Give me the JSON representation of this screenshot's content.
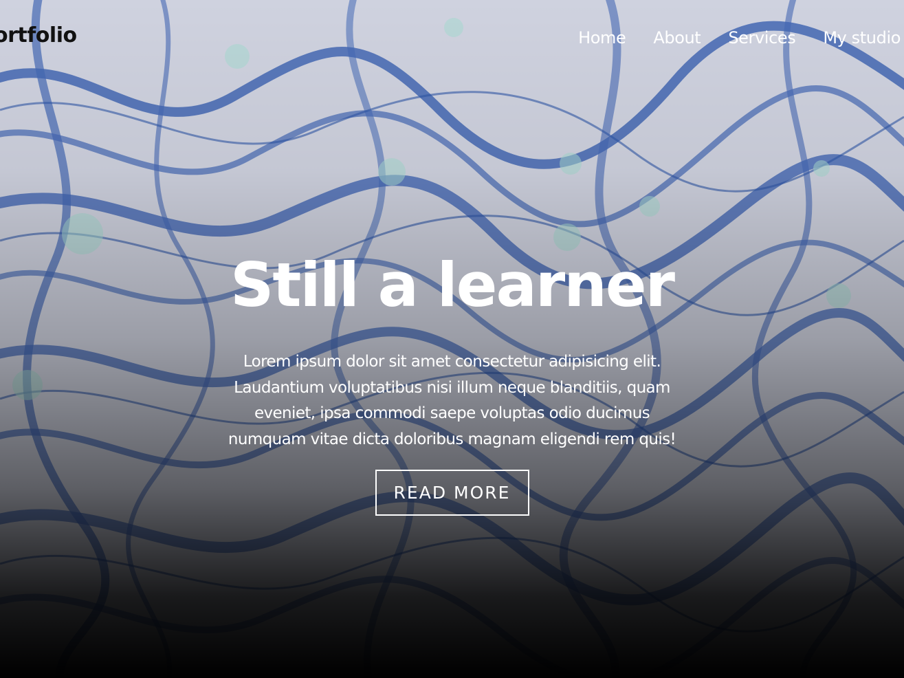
{
  "header": {
    "logo_text": "ortfolio",
    "nav": [
      {
        "label": "Home"
      },
      {
        "label": "About"
      },
      {
        "label": "Services"
      },
      {
        "label": "My studio"
      }
    ]
  },
  "hero": {
    "title": "Still a learner",
    "paragraph_lines": [
      "Lorem ipsum dolor sit amet consectetur adipisicing elit.",
      "Laudantium voluptatibus nisi illum neque blanditiis, quam",
      "eveniet, ipsa commodi saepe voluptas odio ducimus",
      "numquam vitae dicta doloribus magnam eligendi rem quis!"
    ],
    "button_label": "READ MORE"
  },
  "colors": {
    "marble_blue": "#3f68b5",
    "marble_light": "#d4d6e3",
    "marble_mint": "#9fd3c8",
    "text_white": "#ffffff",
    "logo_dark": "#111111"
  }
}
